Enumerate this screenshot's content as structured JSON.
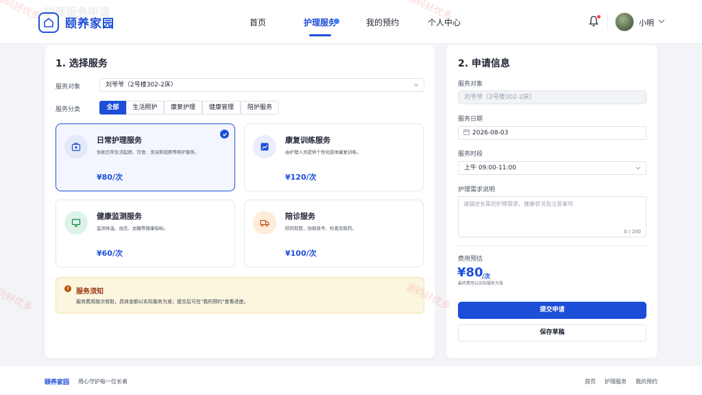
{
  "app": {
    "brand": "颐养家园",
    "ghost_title": "护理服务申请"
  },
  "nav": {
    "items": [
      "首页",
      "护理服务",
      "我的预约",
      "个人中心"
    ],
    "active": "护理服务"
  },
  "user": {
    "name": "小明"
  },
  "left": {
    "title": "1. 选择服务",
    "target_label": "服务对象",
    "target_value": "刘爷爷（2号楼302-2床）",
    "category_label": "服务分类",
    "filters": [
      "全部",
      "生活照护",
      "康复护理",
      "健康管理",
      "陪护服务"
    ],
    "cards": [
      {
        "title": "日常护理服务",
        "desc": "协助日常生活起居、饮食、洗浴和如厕等照护服务。",
        "price": "¥80/次",
        "icon": "medkit-icon",
        "selected": true
      },
      {
        "title": "康复训练服务",
        "desc": "由护理人员提供个性化肢体康复训练。",
        "price": "¥120/次",
        "icon": "trend-chart-icon",
        "selected": false
      },
      {
        "title": "健康监测服务",
        "desc": "监测体温、血压、血糖等健康指标。",
        "price": "¥60/次",
        "icon": "monitor-icon",
        "selected": false
      },
      {
        "title": "陪诊服务",
        "desc": "陪同就医，协助挂号、检查及取药。",
        "price": "¥100/次",
        "icon": "truck-icon",
        "selected": false
      }
    ],
    "notice": {
      "title": "服务须知",
      "text": "服务费用按次收取，具体金额以实际服务为准；提交后可在\"我的预约\"查看进度。"
    }
  },
  "right": {
    "title": "2. 申请信息",
    "target_label": "服务对象",
    "target_value": "刘爷爷（2号楼302-2床）",
    "date_label": "服务日期",
    "date_value": "2026-08-03",
    "time_label": "服务时段",
    "time_value": "上午 09:00-11:00",
    "need_label": "护理需求说明",
    "need_placeholder": "请描述长辈的护理需求、健康状况及注意事项",
    "counter": "0 / 200",
    "fee_label": "费用预估",
    "fee_amount": "¥80",
    "fee_unit": "/次",
    "fee_note": "最终费用以实际服务为准",
    "submit": "提交申请",
    "save": "保存草稿"
  },
  "footer": {
    "brand": "颐养家园",
    "slogan": "用心守护每一位长者",
    "links": [
      "首页",
      "护理服务",
      "我的预约"
    ]
  },
  "watermark": "源码好优多",
  "colors": {
    "primary": "#1d4ed8",
    "notice_bg": "#fdf6df",
    "notice_title": "#9a3412"
  }
}
